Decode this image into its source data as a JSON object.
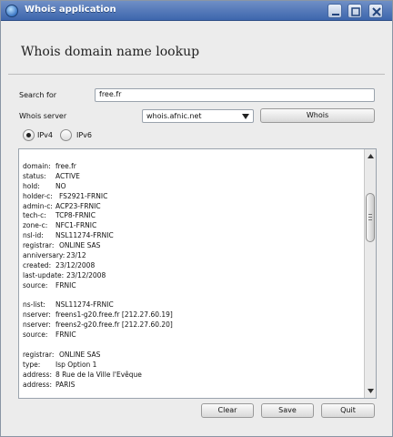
{
  "window": {
    "title": "Whois application"
  },
  "heading": "Whois domain name lookup",
  "form": {
    "search_label": "Search for",
    "search_value": "free.fr",
    "server_label": "Whois server",
    "server_value": "whois.afnic.net",
    "whois_button": "Whois",
    "ipv4_label": "IPv4",
    "ipv6_label": "IPv6",
    "selected_protocol": "IPv4"
  },
  "output": {
    "lines": [
      {
        "k": "domain:",
        "v": "free.fr"
      },
      {
        "k": "status:",
        "v": "ACTIVE"
      },
      {
        "k": "hold:",
        "v": "NO"
      },
      {
        "k": "holder-c:",
        "v": "FS2921-FRNIC"
      },
      {
        "k": "admin-c:",
        "v": "ACP23-FRNIC"
      },
      {
        "k": "tech-c:",
        "v": "TCP8-FRNIC"
      },
      {
        "k": "zone-c:",
        "v": "NFC1-FRNIC"
      },
      {
        "k": "nsl-id:",
        "v": "NSL11274-FRNIC"
      },
      {
        "k": "registrar:",
        "v": "ONLINE SAS"
      },
      {
        "k": "anniversary:",
        "v": "23/12"
      },
      {
        "k": "created:",
        "v": "23/12/2008"
      },
      {
        "k": "last-update:",
        "v": "23/12/2008"
      },
      {
        "k": "source:",
        "v": "FRNIC"
      },
      {
        "k": "",
        "v": ""
      },
      {
        "k": "ns-list:",
        "v": "NSL11274-FRNIC"
      },
      {
        "k": "nserver:",
        "v": "freens1-g20.free.fr [212.27.60.19]"
      },
      {
        "k": "nserver:",
        "v": "freens2-g20.free.fr [212.27.60.20]"
      },
      {
        "k": "source:",
        "v": "FRNIC"
      },
      {
        "k": "",
        "v": ""
      },
      {
        "k": "registrar:",
        "v": "ONLINE SAS"
      },
      {
        "k": "type:",
        "v": "Isp Option 1"
      },
      {
        "k": "address:",
        "v": "8 Rue de la Ville l'Evêque"
      },
      {
        "k": "address:",
        "v": "PARIS"
      }
    ]
  },
  "buttons": {
    "clear": "Clear",
    "save": "Save",
    "quit": "Quit"
  }
}
